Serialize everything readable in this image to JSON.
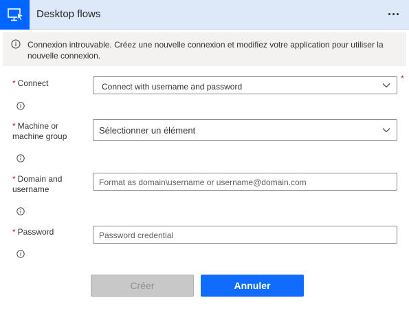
{
  "header": {
    "title": "Desktop flows",
    "app_icon": "desktop-flow-icon",
    "more_icon": "more-options-icon"
  },
  "banner": {
    "icon": "info-icon",
    "text": "Connexion introuvable. Créez une nouvelle connexion et modifiez votre application pour utiliser la nouvelle connexion."
  },
  "form": {
    "required_mark": "*",
    "connect": {
      "label": "Connect",
      "value": "Connect with username and password"
    },
    "machine": {
      "label": "Machine or machine group",
      "value": "Sélectionner un élément"
    },
    "domain": {
      "label": "Domain and username",
      "placeholder": "Format as domain\\username or username@domain.com"
    },
    "password": {
      "label": "Password",
      "placeholder": "Password credential"
    }
  },
  "buttons": {
    "create": "Créer",
    "cancel": "Annuler"
  },
  "colors": {
    "header_bg": "#dde8f9",
    "brand": "#0066ff",
    "required": "#a4262c",
    "primary_button": "#0f6cff",
    "disabled_button": "#c8c8c8"
  }
}
